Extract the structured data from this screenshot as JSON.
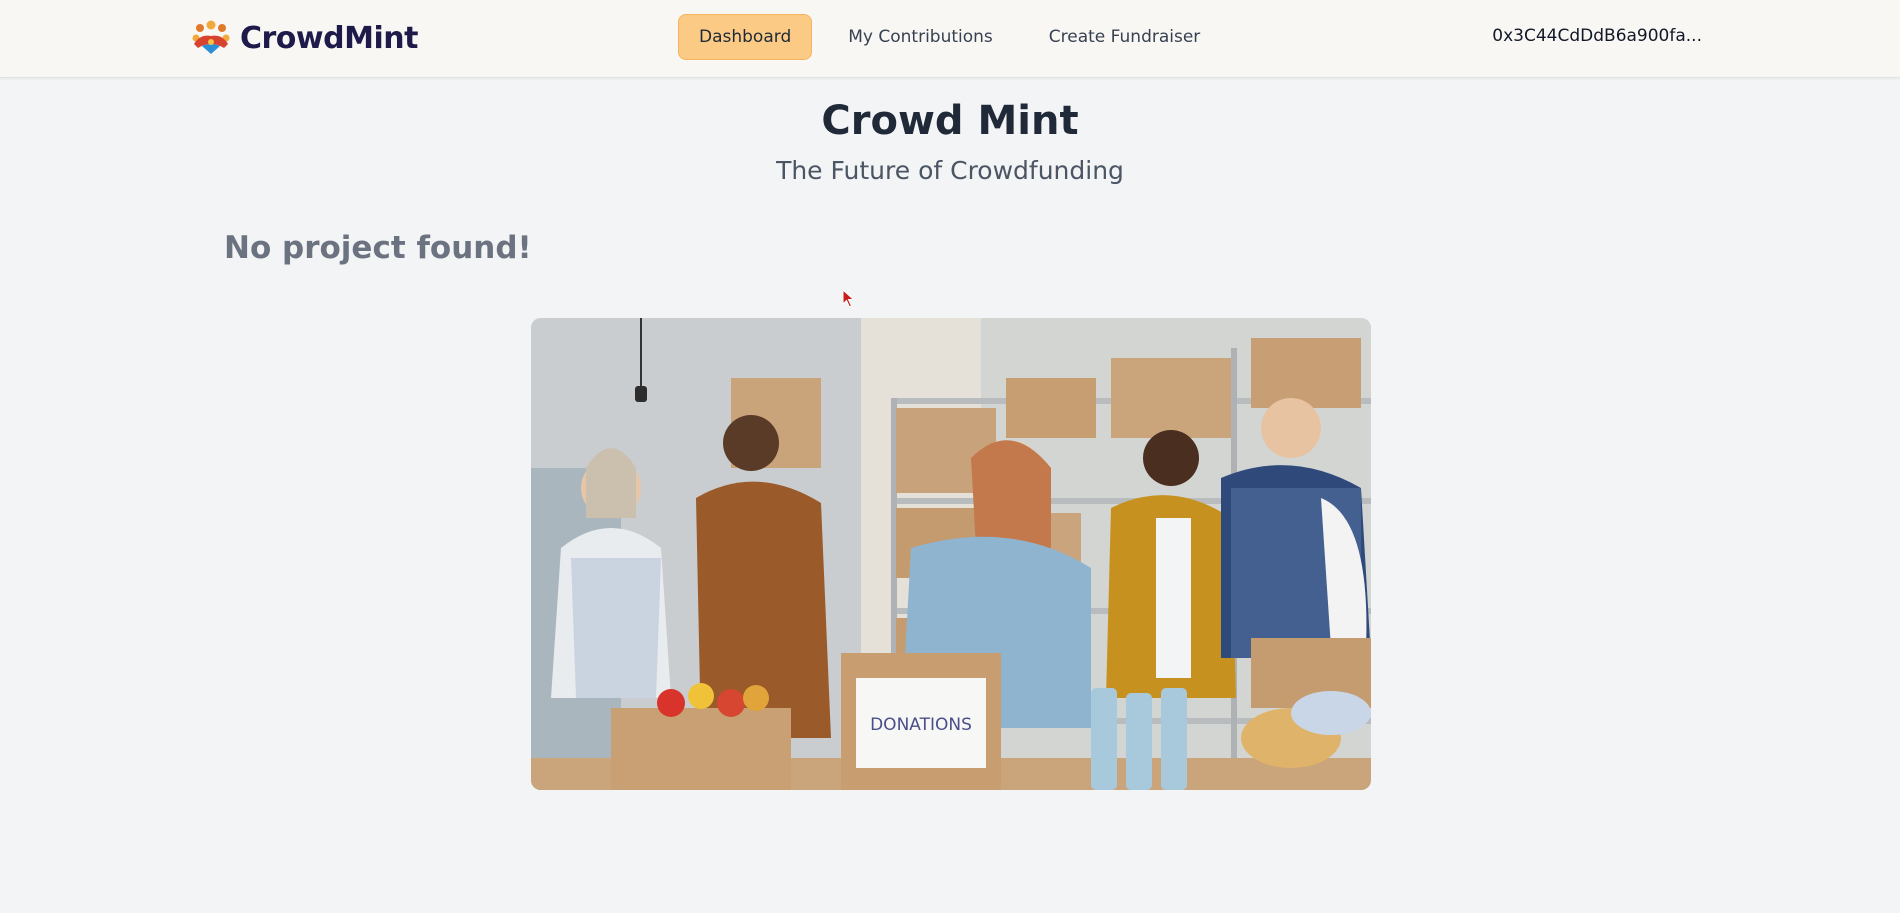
{
  "brand": {
    "name": "CrowdMint",
    "logo_icon": "people-group-icon"
  },
  "nav": {
    "items": [
      {
        "label": "Dashboard",
        "active": true
      },
      {
        "label": "My Contributions",
        "active": false
      },
      {
        "label": "Create Fundraiser",
        "active": false
      }
    ]
  },
  "wallet": {
    "address": "0x3C44CdDdB6a900fa..."
  },
  "hero": {
    "title": "Crowd Mint",
    "subtitle": "The Future of Crowdfunding"
  },
  "main": {
    "empty_message": "No project found!",
    "image": {
      "box_label": "DONATIONS"
    }
  },
  "colors": {
    "accent": "#fbcb85",
    "nav_bg": "#f8f7f4",
    "page_bg": "#f3f4f6",
    "brand_text": "#1e1b4b"
  }
}
